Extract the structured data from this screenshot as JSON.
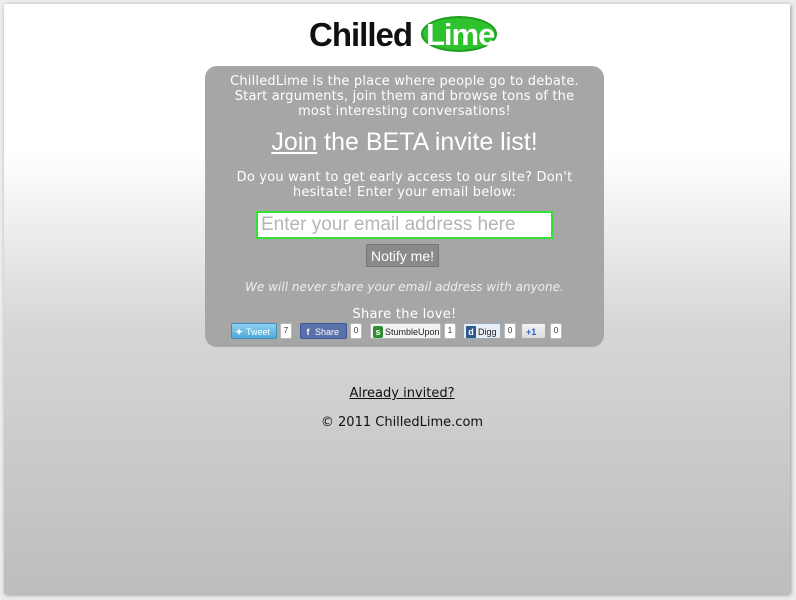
{
  "logo": {
    "part1": "Chilled",
    "part2": "Lime"
  },
  "panel": {
    "intro": "ChilledLime is the place where people go to debate. Start arguments, join them and browse tons of the most interesting conversations!",
    "headline_link": "Join",
    "headline_rest": " the BETA invite list!",
    "question": "Do you want to get early access to our site? Don't hesitate! Enter your email below:",
    "email_placeholder": "Enter your email address here",
    "notify_label": "Notify me!",
    "privacy": "We will never share your email address with anyone.",
    "share_title": "Share the love!"
  },
  "share": {
    "tweet": {
      "label": "Tweet",
      "count": "7"
    },
    "facebook": {
      "label": "Share",
      "count": "0"
    },
    "stumbleupon": {
      "label": "StumbleUpon",
      "count": "1"
    },
    "digg": {
      "label": "Digg",
      "count": "0"
    },
    "gplus": {
      "label": "+1",
      "count": "0"
    }
  },
  "footer": {
    "already_invited": "Already invited?",
    "copyright": "© 2011 ChilledLime.com"
  },
  "colors": {
    "accent": "#2ec22e",
    "panel": "#a6a6a6",
    "input_border": "#33e033"
  }
}
